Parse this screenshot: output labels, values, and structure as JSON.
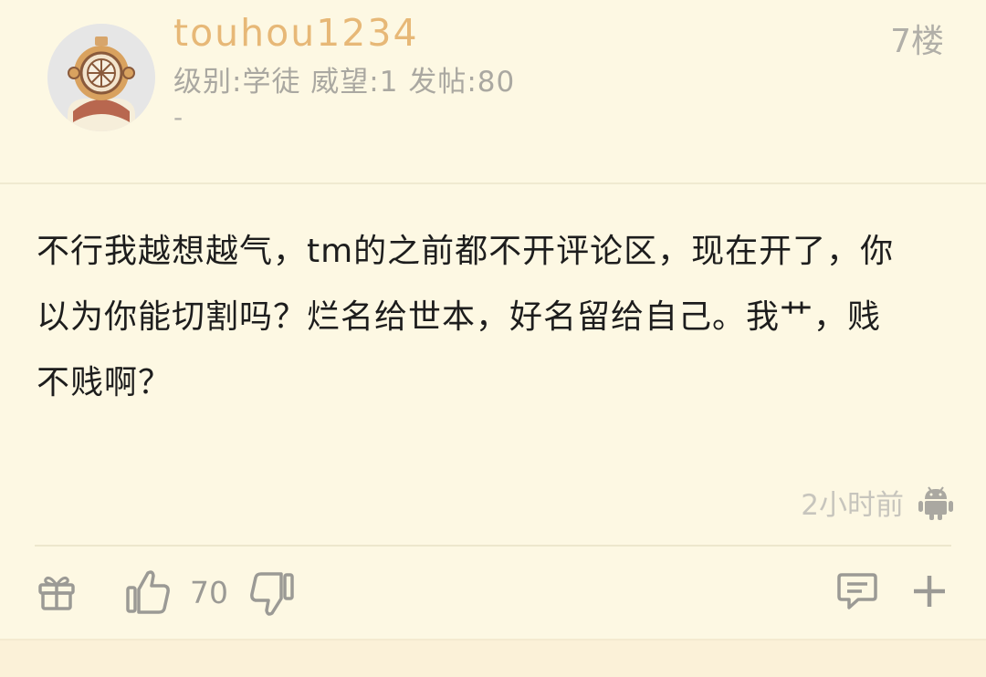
{
  "user": {
    "name": "touhou1234",
    "stats": "级别:学徒 威望:1 发帖:80",
    "signature": "-"
  },
  "post": {
    "floor": "7楼",
    "content": "不行我越想越气，tm的之前都不开评论区，现在开了，你以为你能切割吗？烂名给世本，好名留给自己。我艹，贱不贱啊？",
    "time": "2小时前"
  },
  "actions": {
    "like_count": "70"
  },
  "colors": {
    "background": "#fdf8e3",
    "username": "#e7b877",
    "muted_text": "#aaa8a1",
    "icon": "#9b9a95"
  }
}
